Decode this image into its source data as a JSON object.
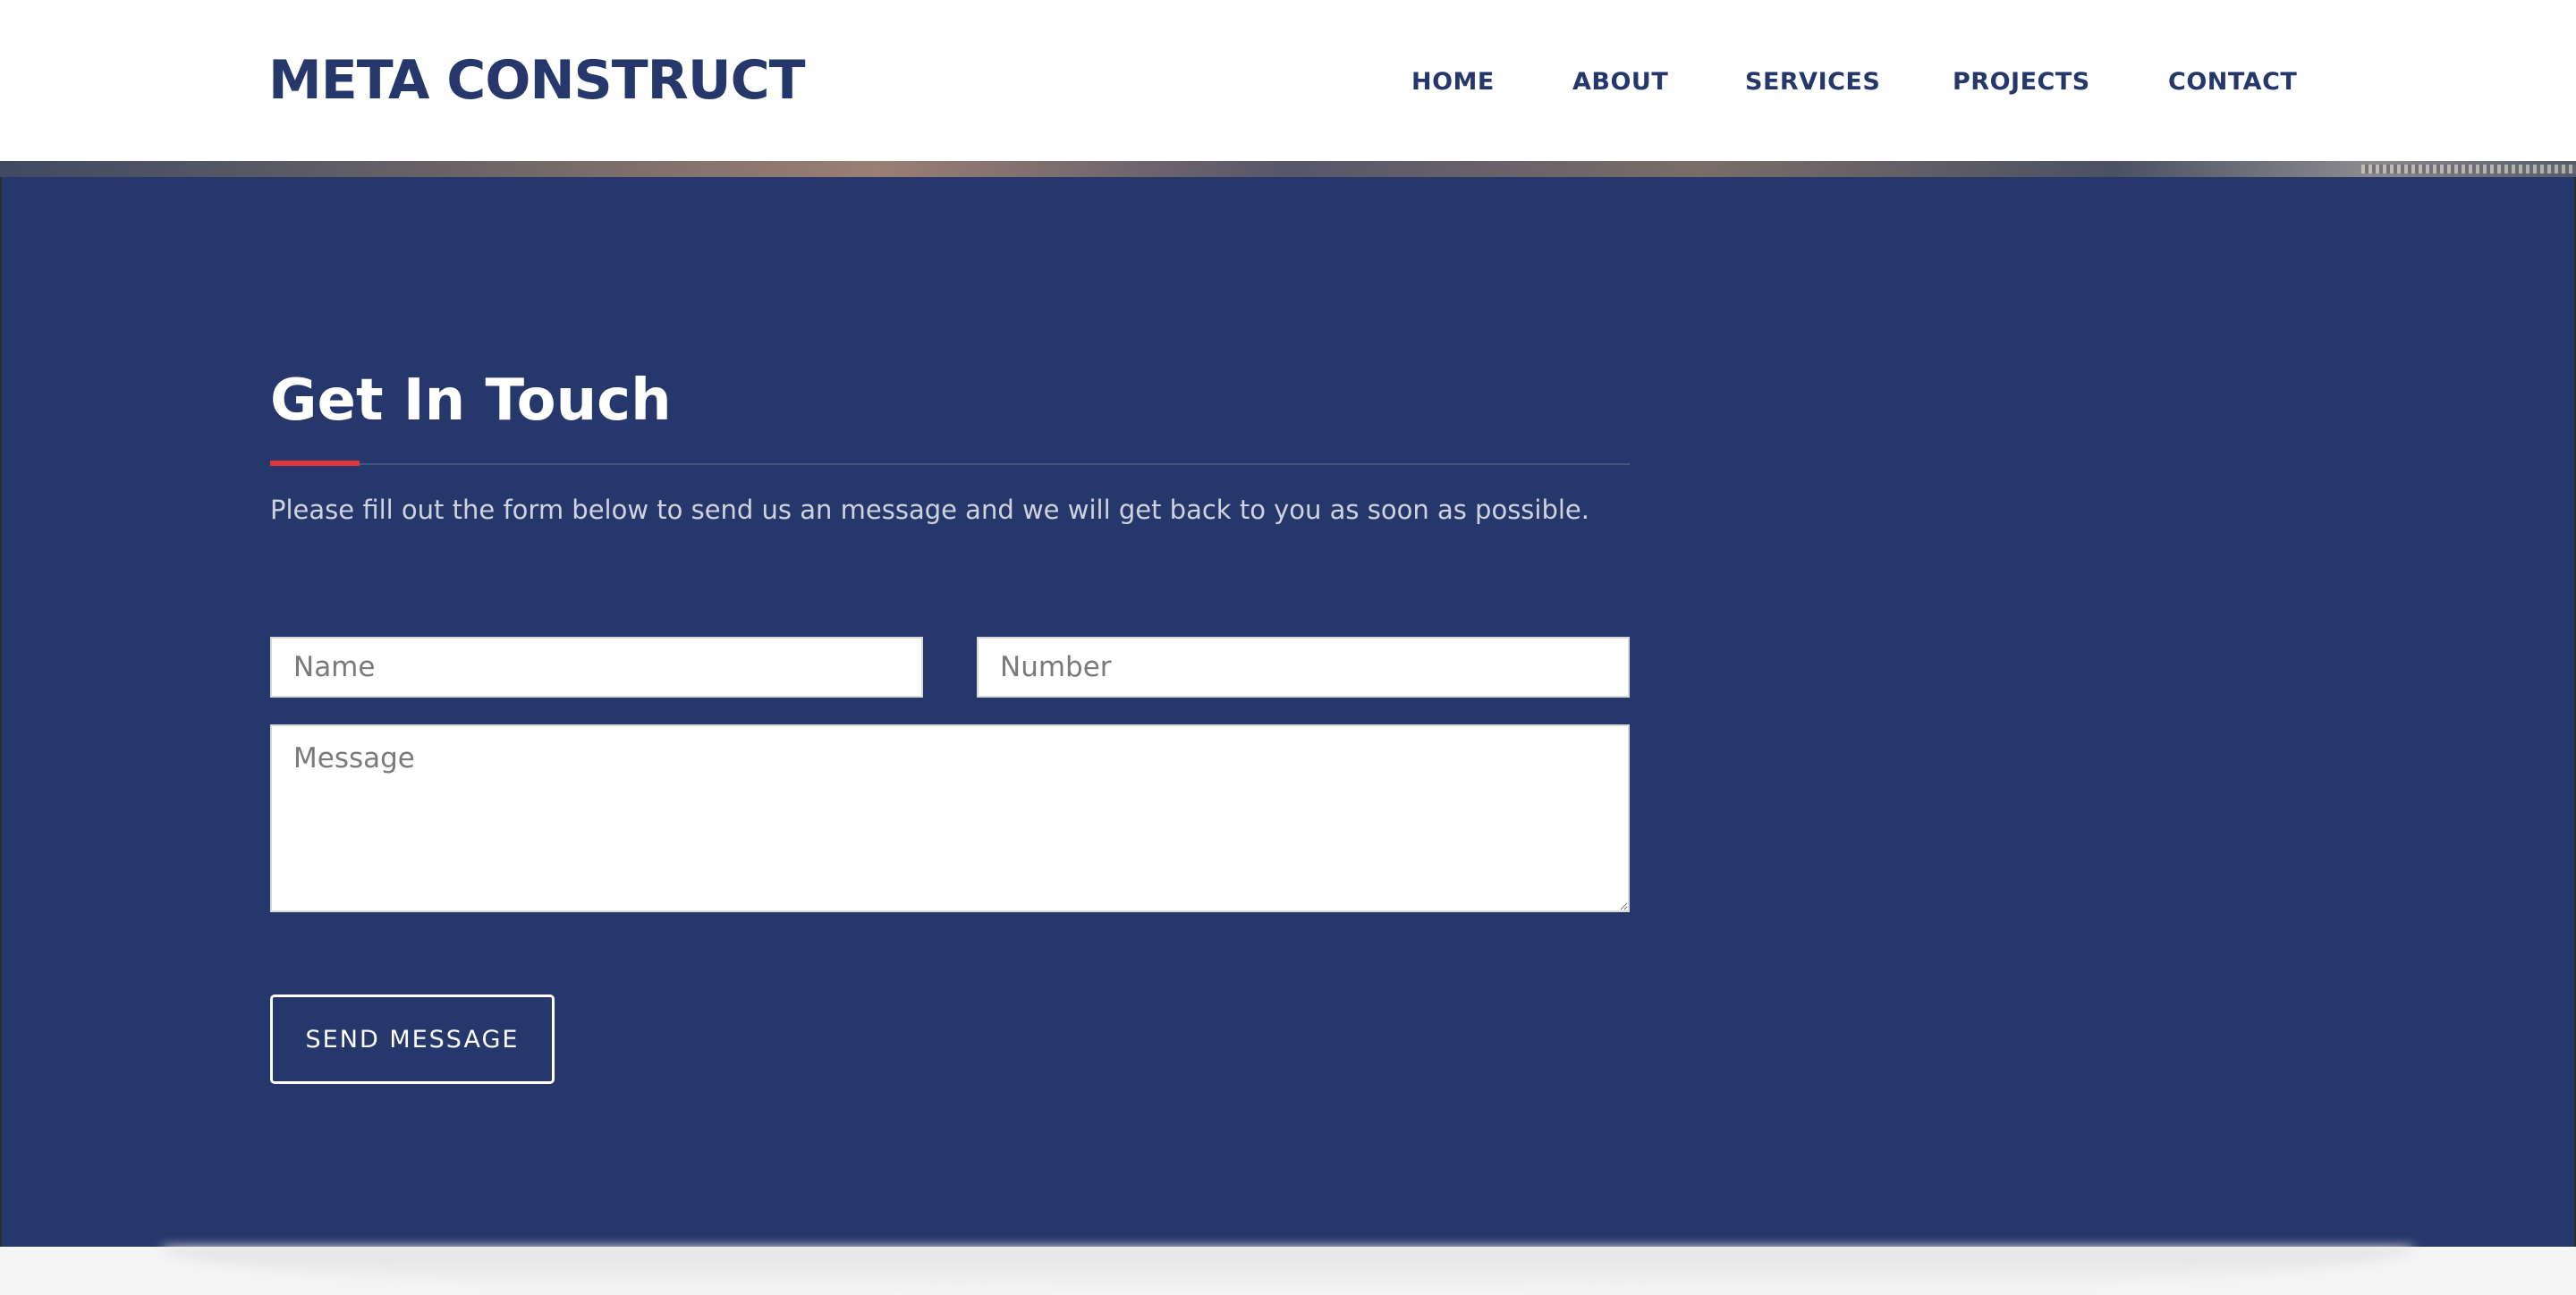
{
  "header": {
    "brand": "META CONSTRUCT",
    "nav": [
      {
        "label": "HOME"
      },
      {
        "label": "ABOUT"
      },
      {
        "label": "SERVICES"
      },
      {
        "label": "PROJECTS"
      },
      {
        "label": "CONTACT"
      }
    ]
  },
  "contact": {
    "title": "Get In Touch",
    "description": "Please fill out the form below to send us an message and we will get back to you as soon as possible.",
    "fields": {
      "name_placeholder": "Name",
      "number_placeholder": "Number",
      "message_placeholder": "Message"
    },
    "submit_label": "SEND MESSAGE"
  },
  "colors": {
    "brand": "#26376b",
    "section_bg": "#26376b",
    "accent": "#e0353d",
    "text_light": "#ffffff"
  }
}
